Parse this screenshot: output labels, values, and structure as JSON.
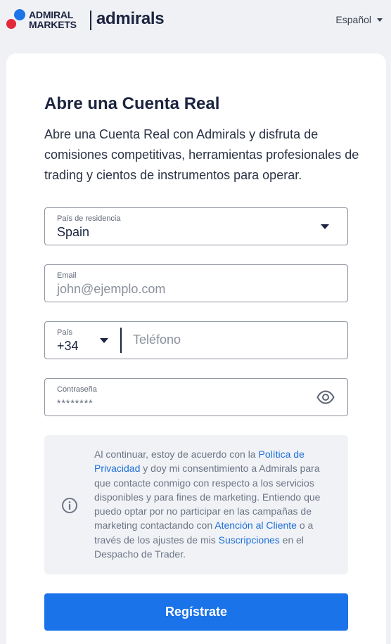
{
  "header": {
    "brand_line1": "ADMIRAL",
    "brand_line2": "MARKETS",
    "brand_name": "admirals",
    "language": "Español",
    "language_icon": "chevron-down-icon"
  },
  "form": {
    "title": "Abre una Cuenta Real",
    "intro": "Abre una Cuenta Real con Admirals y disfruta de comisiones competitivas, herramientas profesionales de trading y cientos de instrumentos para operar.",
    "country": {
      "label": "País de residencia",
      "value": "Spain"
    },
    "email": {
      "label": "Email",
      "placeholder": "john@ejemplo.com"
    },
    "phone": {
      "code_label": "País",
      "code_value": "+34",
      "placeholder": "Teléfono"
    },
    "password": {
      "label": "Contraseña",
      "mask": "********",
      "toggle_icon": "eye-icon"
    },
    "consent": {
      "icon": "info-icon",
      "text_1": "Al continuar, estoy de acuerdo con la ",
      "link_privacy": "Política de Privacidad",
      "text_2": " y doy mi consentimiento a Admirals para que contacte conmigo con respecto a los servicios disponibles y para fines de marketing. Entiendo que puedo optar por no participar en las campañas de marketing contactando con ",
      "link_support": "Atención al Cliente",
      "text_3": " o a través de los ajustes de mis ",
      "link_subscriptions": "Suscripciones",
      "text_4": " en el Despacho de Trader."
    },
    "submit_label": "Regístrate"
  },
  "colors": {
    "accent": "#1a73e8",
    "brand_blue": "#1d73e8",
    "brand_red": "#e22839",
    "navy": "#1b2440",
    "background": "#f0f1f5"
  }
}
